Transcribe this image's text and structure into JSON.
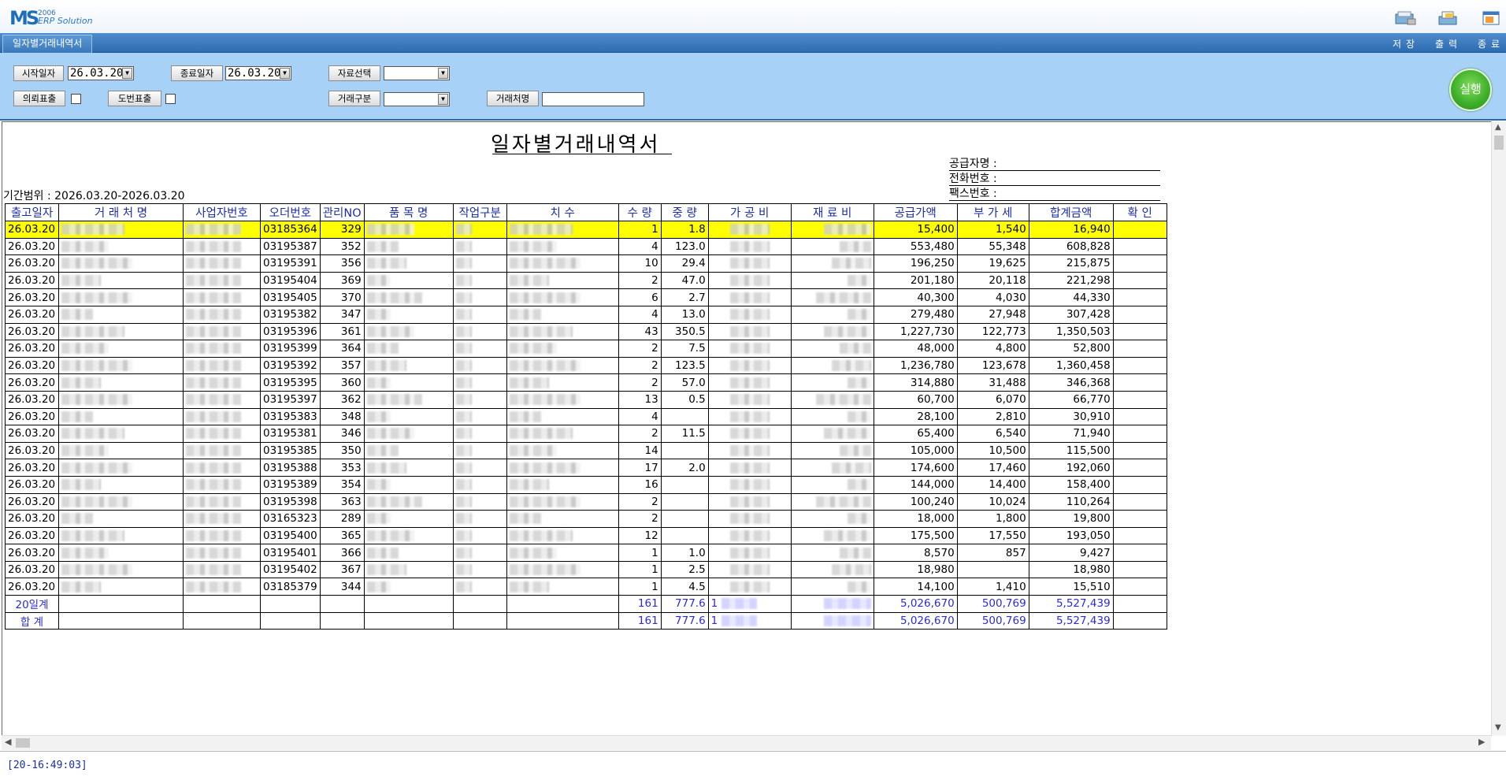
{
  "app": {
    "logo_year": "2006",
    "logo_name": "ERP Solution",
    "tab_title": "일자별거래내역서",
    "toolbar": {
      "save": "저장",
      "print": "출력",
      "exit": "종료"
    }
  },
  "filters": {
    "start_label": "시작일자",
    "start_value": "26.03.20",
    "end_label": "종료일자",
    "end_value": "26.03.20",
    "data_select_label": "자료선택",
    "data_select_value": "",
    "trade_type_label": "거래구분",
    "trade_type_value": "",
    "client_label": "거래처명",
    "client_value": "",
    "request_show_label": "의뢰표출",
    "drawing_show_label": "도번표출",
    "run_label": "실행"
  },
  "report": {
    "title": "일자별거래내역서",
    "supplier_name_label": "공급자명 :",
    "phone_label": "전화번호 :",
    "fax_label": "팩스번호 :",
    "period_label": "기간범위 : 2026.03.20-2026.03.20",
    "columns": [
      "출고일자",
      "거 래 처 명",
      "사업자번호",
      "오더번호",
      "관리NO",
      "품 목 명",
      "작업구분",
      "치 수",
      "수 량",
      "중 량",
      "가 공 비",
      "재 료 비",
      "공급가액",
      "부 가 세",
      "합계금액",
      "확 인"
    ],
    "rows": [
      {
        "date": "26.03.20",
        "order": "03185364",
        "no": "329",
        "qty": "1",
        "weight": "1.8",
        "supply": "15,400",
        "vat": "1,540",
        "total": "16,940"
      },
      {
        "date": "26.03.20",
        "order": "03195387",
        "no": "352",
        "qty": "4",
        "weight": "123.0",
        "supply": "553,480",
        "vat": "55,348",
        "total": "608,828"
      },
      {
        "date": "26.03.20",
        "order": "03195391",
        "no": "356",
        "qty": "10",
        "weight": "29.4",
        "supply": "196,250",
        "vat": "19,625",
        "total": "215,875"
      },
      {
        "date": "26.03.20",
        "order": "03195404",
        "no": "369",
        "qty": "2",
        "weight": "47.0",
        "supply": "201,180",
        "vat": "20,118",
        "total": "221,298"
      },
      {
        "date": "26.03.20",
        "order": "03195405",
        "no": "370",
        "qty": "6",
        "weight": "2.7",
        "supply": "40,300",
        "vat": "4,030",
        "total": "44,330"
      },
      {
        "date": "26.03.20",
        "order": "03195382",
        "no": "347",
        "qty": "4",
        "weight": "13.0",
        "supply": "279,480",
        "vat": "27,948",
        "total": "307,428"
      },
      {
        "date": "26.03.20",
        "order": "03195396",
        "no": "361",
        "qty": "43",
        "weight": "350.5",
        "supply": "1,227,730",
        "vat": "122,773",
        "total": "1,350,503"
      },
      {
        "date": "26.03.20",
        "order": "03195399",
        "no": "364",
        "qty": "2",
        "weight": "7.5",
        "supply": "48,000",
        "vat": "4,800",
        "total": "52,800"
      },
      {
        "date": "26.03.20",
        "order": "03195392",
        "no": "357",
        "qty": "2",
        "weight": "123.5",
        "supply": "1,236,780",
        "vat": "123,678",
        "total": "1,360,458"
      },
      {
        "date": "26.03.20",
        "order": "03195395",
        "no": "360",
        "qty": "2",
        "weight": "57.0",
        "supply": "314,880",
        "vat": "31,488",
        "total": "346,368"
      },
      {
        "date": "26.03.20",
        "order": "03195397",
        "no": "362",
        "qty": "13",
        "weight": "0.5",
        "supply": "60,700",
        "vat": "6,070",
        "total": "66,770"
      },
      {
        "date": "26.03.20",
        "order": "03195383",
        "no": "348",
        "qty": "4",
        "weight": "",
        "supply": "28,100",
        "vat": "2,810",
        "total": "30,910"
      },
      {
        "date": "26.03.20",
        "order": "03195381",
        "no": "346",
        "qty": "2",
        "weight": "11.5",
        "supply": "65,400",
        "vat": "6,540",
        "total": "71,940"
      },
      {
        "date": "26.03.20",
        "order": "03195385",
        "no": "350",
        "qty": "14",
        "weight": "",
        "supply": "105,000",
        "vat": "10,500",
        "total": "115,500"
      },
      {
        "date": "26.03.20",
        "order": "03195388",
        "no": "353",
        "qty": "17",
        "weight": "2.0",
        "supply": "174,600",
        "vat": "17,460",
        "total": "192,060"
      },
      {
        "date": "26.03.20",
        "order": "03195389",
        "no": "354",
        "qty": "16",
        "weight": "",
        "supply": "144,000",
        "vat": "14,400",
        "total": "158,400"
      },
      {
        "date": "26.03.20",
        "order": "03195398",
        "no": "363",
        "qty": "2",
        "weight": "",
        "supply": "100,240",
        "vat": "10,024",
        "total": "110,264"
      },
      {
        "date": "26.03.20",
        "order": "03165323",
        "no": "289",
        "qty": "2",
        "weight": "",
        "supply": "18,000",
        "vat": "1,800",
        "total": "19,800"
      },
      {
        "date": "26.03.20",
        "order": "03195400",
        "no": "365",
        "qty": "12",
        "weight": "",
        "supply": "175,500",
        "vat": "17,550",
        "total": "193,050"
      },
      {
        "date": "26.03.20",
        "order": "03195401",
        "no": "366",
        "qty": "1",
        "weight": "1.0",
        "supply": "8,570",
        "vat": "857",
        "total": "9,427"
      },
      {
        "date": "26.03.20",
        "order": "03195402",
        "no": "367",
        "qty": "1",
        "weight": "2.5",
        "supply": "18,980",
        "vat": "",
        "total": "18,980"
      },
      {
        "date": "26.03.20",
        "order": "03185379",
        "no": "344",
        "qty": "1",
        "weight": "4.5",
        "supply": "14,100",
        "vat": "1,410",
        "total": "15,510"
      }
    ],
    "subtotal": {
      "label": "20일계",
      "qty": "161",
      "weight": "777.6",
      "proc": "1",
      "supply": "5,026,670",
      "vat": "500,769",
      "total": "5,527,439"
    },
    "grandtotal": {
      "label": "합 계",
      "qty": "161",
      "weight": "777.6",
      "proc": "1",
      "supply": "5,026,670",
      "vat": "500,769",
      "total": "5,527,439"
    }
  },
  "status": {
    "text": "[20-16:49:03]"
  }
}
